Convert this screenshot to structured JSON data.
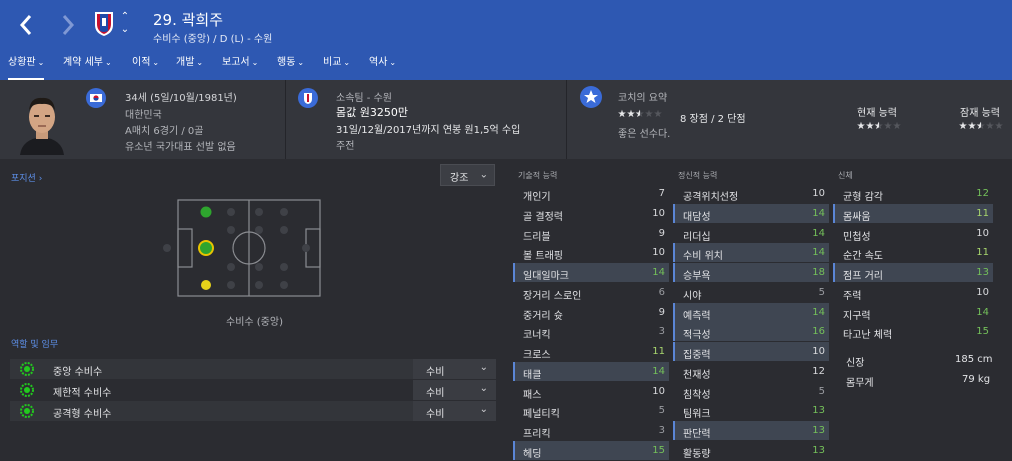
{
  "header": {
    "player_name": "29. 곽희주",
    "subtitle": "수비수 (중앙) / D (L) - 수원",
    "back_icon": "chevron-left-icon",
    "forward_icon": "chevron-right-icon",
    "switch_up": "⌃",
    "switch_down": "⌄"
  },
  "menu": [
    {
      "label": "상황판"
    },
    {
      "label": "계약 세부"
    },
    {
      "label": "이적"
    },
    {
      "label": "개발"
    },
    {
      "label": "보고서"
    },
    {
      "label": "행동"
    },
    {
      "label": "비교"
    },
    {
      "label": "역사"
    }
  ],
  "personal": {
    "age_dob": "34세 (5일/10월/1981년)",
    "nation": "대한민국",
    "caps": "A매치 6경기 / 0골",
    "youth": "유소년 국가대표 선발 없음"
  },
  "contract": {
    "club": "소속팀 - 수원",
    "value": "몸값 원3250만",
    "wage": "31일/12월/2017년까지 연봉 원1,5억 수입",
    "status": "주전"
  },
  "coach": {
    "title": "코치의 요약",
    "summary_stars": 2.5,
    "strengths": "8 장점 / 2 단점",
    "comment": "좋은 선수다.",
    "current_label": "현재 능력",
    "current_stars": 2.5,
    "potential_label": "잠재 능력",
    "potential_stars": 2.5
  },
  "positions": {
    "label": "포지션 ›",
    "dropdown": "강조",
    "caption": "수비수 (중앙)"
  },
  "roles": {
    "label": "역할 및 임무",
    "items": [
      {
        "name": "중앙 수비수",
        "duty": "수비"
      },
      {
        "name": "제한적 수비수",
        "duty": "수비"
      },
      {
        "name": "공격형 수비수",
        "duty": "수비"
      }
    ]
  },
  "attributes": {
    "technical_title": "기술적 능력",
    "mental_title": "정신적 능력",
    "physical_title": "신체",
    "technical": [
      {
        "name": "개인기",
        "value": "7",
        "hl": false,
        "color": "white"
      },
      {
        "name": "골 결정력",
        "value": "10",
        "hl": false,
        "color": "white"
      },
      {
        "name": "드리블",
        "value": "9",
        "hl": false,
        "color": "white"
      },
      {
        "name": "볼 트래핑",
        "value": "10",
        "hl": false,
        "color": "white"
      },
      {
        "name": "일대일마크",
        "value": "14",
        "hl": true,
        "color": "green"
      },
      {
        "name": "장거리 스로인",
        "value": "6",
        "hl": false,
        "color": "gray"
      },
      {
        "name": "중거리 슛",
        "value": "9",
        "hl": false,
        "color": "white"
      },
      {
        "name": "코너킥",
        "value": "3",
        "hl": false,
        "color": "gray"
      },
      {
        "name": "크로스",
        "value": "11",
        "hl": false,
        "color": "lgreen"
      },
      {
        "name": "태클",
        "value": "14",
        "hl": true,
        "color": "green"
      },
      {
        "name": "패스",
        "value": "10",
        "hl": false,
        "color": "white"
      },
      {
        "name": "페널티킥",
        "value": "5",
        "hl": false,
        "color": "gray"
      },
      {
        "name": "프리킥",
        "value": "3",
        "hl": false,
        "color": "gray"
      },
      {
        "name": "헤딩",
        "value": "15",
        "hl": true,
        "color": "green"
      }
    ],
    "mental": [
      {
        "name": "공격위치선정",
        "value": "10",
        "hl": false,
        "color": "white"
      },
      {
        "name": "대담성",
        "value": "14",
        "hl": true,
        "color": "green"
      },
      {
        "name": "리더십",
        "value": "14",
        "hl": false,
        "color": "green"
      },
      {
        "name": "수비 위치",
        "value": "14",
        "hl": true,
        "color": "green"
      },
      {
        "name": "승부욕",
        "value": "18",
        "hl": true,
        "color": "green"
      },
      {
        "name": "시야",
        "value": "5",
        "hl": false,
        "color": "gray"
      },
      {
        "name": "예측력",
        "value": "14",
        "hl": true,
        "color": "green"
      },
      {
        "name": "적극성",
        "value": "16",
        "hl": true,
        "color": "green"
      },
      {
        "name": "집중력",
        "value": "10",
        "hl": true,
        "color": "white"
      },
      {
        "name": "천재성",
        "value": "12",
        "hl": false,
        "color": "white"
      },
      {
        "name": "침착성",
        "value": "5",
        "hl": false,
        "color": "gray"
      },
      {
        "name": "팀워크",
        "value": "13",
        "hl": false,
        "color": "green"
      },
      {
        "name": "판단력",
        "value": "13",
        "hl": true,
        "color": "green"
      },
      {
        "name": "활동량",
        "value": "13",
        "hl": false,
        "color": "green"
      }
    ],
    "physical": [
      {
        "name": "균형 감각",
        "value": "12",
        "hl": false,
        "color": "green"
      },
      {
        "name": "몸싸움",
        "value": "11",
        "hl": true,
        "color": "lgreen"
      },
      {
        "name": "민첩성",
        "value": "10",
        "hl": false,
        "color": "white"
      },
      {
        "name": "순간 속도",
        "value": "11",
        "hl": false,
        "color": "lgreen"
      },
      {
        "name": "점프 거리",
        "value": "13",
        "hl": true,
        "color": "green"
      },
      {
        "name": "주력",
        "value": "10",
        "hl": false,
        "color": "white"
      },
      {
        "name": "지구력",
        "value": "14",
        "hl": false,
        "color": "green"
      },
      {
        "name": "타고난 체력",
        "value": "15",
        "hl": false,
        "color": "green"
      }
    ],
    "height_label": "신장",
    "height": "185 cm",
    "weight_label": "몸무게",
    "weight": "79 kg"
  }
}
